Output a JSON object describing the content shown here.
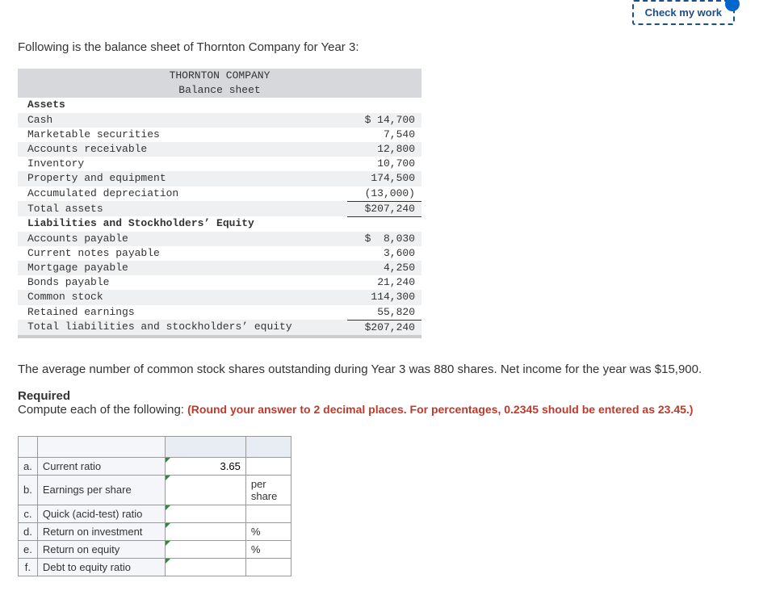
{
  "header": {
    "check_btn": "Check my work"
  },
  "intro": "Following is the balance sheet of Thornton Company for Year 3:",
  "bs": {
    "title1": "THORNTON COMPANY",
    "title2": "Balance sheet",
    "assets_head": "Assets",
    "rows_assets": [
      {
        "label": "Cash",
        "value": "$ 14,700"
      },
      {
        "label": "Marketable securities",
        "value": "7,540"
      },
      {
        "label": "Accounts receivable",
        "value": "12,800"
      },
      {
        "label": "Inventory",
        "value": "10,700"
      },
      {
        "label": "Property and equipment",
        "value": "174,500"
      },
      {
        "label": "Accumulated depreciation",
        "value": "(13,000)"
      }
    ],
    "total_assets_label": "Total assets",
    "total_assets_value": "$207,240",
    "liab_head": "Liabilities and Stockholders’ Equity",
    "rows_liab": [
      {
        "label": "Accounts payable",
        "value": "$  8,030"
      },
      {
        "label": "Current notes payable",
        "value": "3,600"
      },
      {
        "label": "Mortgage payable",
        "value": "4,250"
      },
      {
        "label": "Bonds payable",
        "value": "21,240"
      },
      {
        "label": "Common stock",
        "value": "114,300"
      },
      {
        "label": "Retained earnings",
        "value": "55,820"
      }
    ],
    "total_liab_label": "Total liabilities and stockholders’ equity",
    "total_liab_value": "$207,240"
  },
  "para2": "The average number of common stock shares outstanding during Year 3 was 880 shares. Net income for the year was $15,900.",
  "required_head": "Required",
  "required_text": "Compute each of the following: ",
  "required_note": "(Round your answer to 2 decimal places. For percentages, 0.2345 should be entered as 23.45.)",
  "answers": {
    "rows": [
      {
        "letter": "a.",
        "label": "Current ratio",
        "value": "3.65",
        "unit": ""
      },
      {
        "letter": "b.",
        "label": "Earnings per share",
        "value": "",
        "unit": "per share"
      },
      {
        "letter": "c.",
        "label": "Quick (acid-test) ratio",
        "value": "",
        "unit": ""
      },
      {
        "letter": "d.",
        "label": "Return on investment",
        "value": "",
        "unit": "%"
      },
      {
        "letter": "e.",
        "label": "Return on equity",
        "value": "",
        "unit": "%"
      },
      {
        "letter": "f.",
        "label": "Debt to equity ratio",
        "value": "",
        "unit": ""
      }
    ]
  }
}
